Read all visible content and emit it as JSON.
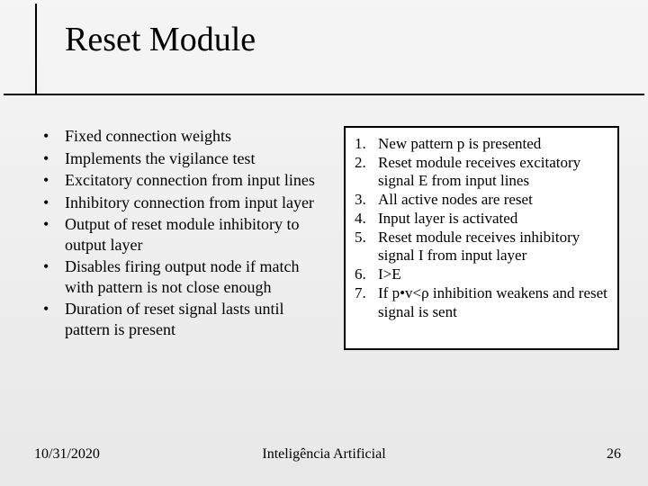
{
  "title": "Reset Module",
  "left_bullets": [
    "Fixed connection weights",
    "Implements the vigilance test",
    "Excitatory connection from input lines",
    "Inhibitory connection from input layer",
    "Output of reset module inhibitory to output layer",
    "Disables firing output node if match with pattern is not close enough",
    "Duration of reset signal lasts until pattern is present"
  ],
  "right_numbered": [
    "New pattern p is presented",
    "Reset module receives excitatory signal E from input lines",
    "All active nodes are reset",
    "Input layer is activated",
    "Reset module receives inhibitory signal I from input layer",
    "I>E",
    "If p•v<ρ inhibition weakens and reset signal is sent"
  ],
  "footer": {
    "date": "10/31/2020",
    "center": "Inteligência Artificial",
    "page": "26"
  }
}
